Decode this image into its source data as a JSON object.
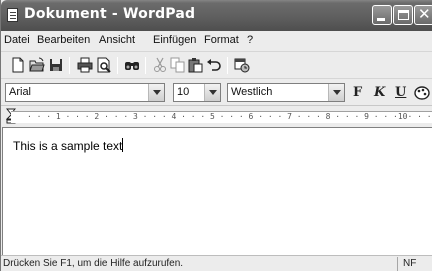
{
  "window": {
    "title": "Dokument - WordPad"
  },
  "menu": {
    "items": [
      {
        "label": "Datei"
      },
      {
        "label": "Bearbeiten"
      },
      {
        "label": "Ansicht"
      },
      {
        "label": "Einfügen"
      },
      {
        "label": "Format"
      },
      {
        "label": "?"
      }
    ]
  },
  "toolbar": {
    "icons": [
      "new-document-icon",
      "open-folder-icon",
      "save-icon",
      "print-icon",
      "print-preview-icon",
      "find-icon",
      "cut-icon",
      "copy-icon",
      "paste-icon",
      "undo-icon",
      "date-time-icon"
    ]
  },
  "format": {
    "font": "Arial",
    "size": "10",
    "script": "Westlich",
    "bold_label": "F",
    "italic_label": "K",
    "underline_label": "U"
  },
  "ruler": {
    "numbers": "· · · 1 · · · 2 · · · 3 · · · 4 · · · 5 · · · 6 · · · 7 · · · 8 · · · 9 · · ·10· · ·11· ·"
  },
  "document": {
    "text": "This is a sample text"
  },
  "status": {
    "help_text": "Drücken Sie F1, um die Hilfe aufzurufen.",
    "mode": "NF"
  },
  "colors": {
    "titlebar": "#5f5f5f",
    "chrome": "#ececec"
  }
}
